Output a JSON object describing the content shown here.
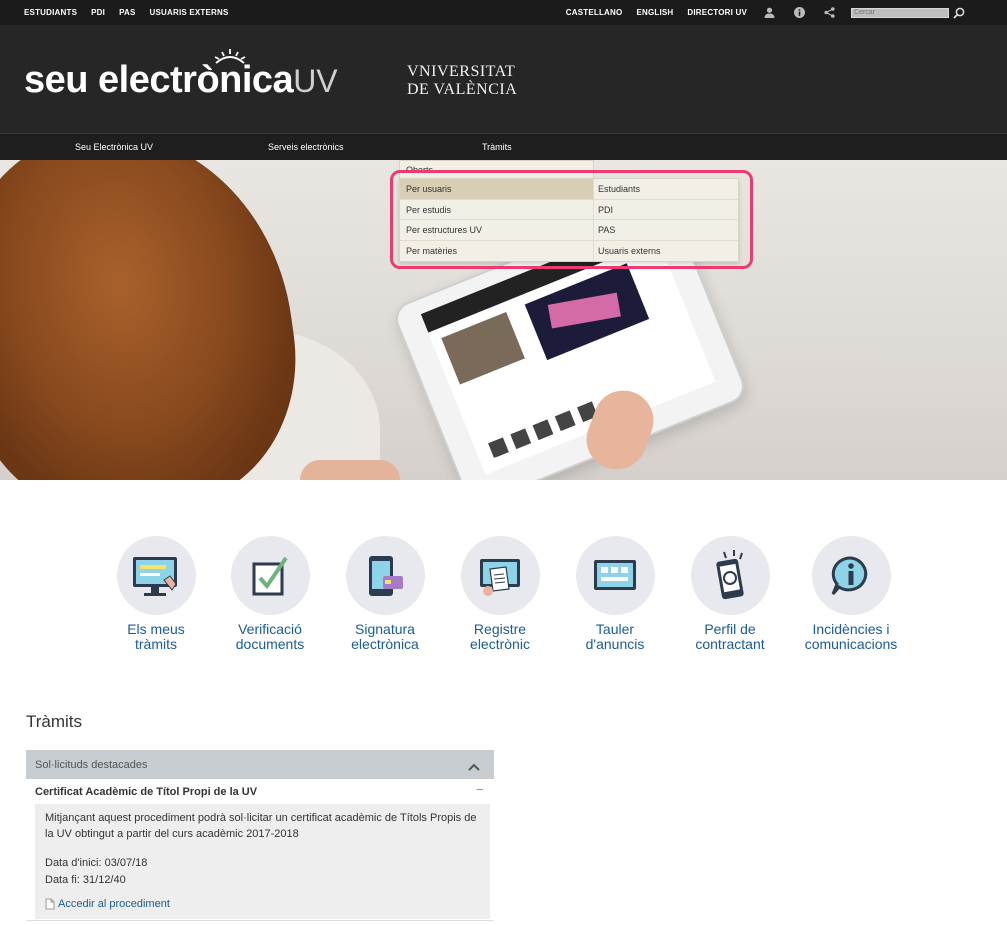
{
  "topbar": {
    "left_links": [
      "ESTUDIANTS",
      "PDI",
      "PAS",
      "USUARIS EXTERNS"
    ],
    "right_links": [
      "CASTELLANO",
      "ENGLISH",
      "DIRECTORI UV"
    ],
    "search_placeholder": "Cercar"
  },
  "header": {
    "brand_main": "seu electrònica",
    "brand_suffix": "UV",
    "uv_logo_line1": "VNIVERSITAT",
    "uv_logo_line2": "DE VALÈNCIA"
  },
  "nav": {
    "items": [
      "Seu Electrònica UV",
      "Serveis electrònics",
      "Tràmits"
    ]
  },
  "dropdown": {
    "first": "Oberts",
    "rows": [
      {
        "label": "Per usuaris",
        "sub": "Estudiants"
      },
      {
        "label": "Per estudis",
        "sub": "PDI"
      },
      {
        "label": "Per estructures UV",
        "sub": "PAS"
      },
      {
        "label": "Per matèries",
        "sub": "Usuaris externs"
      }
    ]
  },
  "services": [
    {
      "line1": "Els meus",
      "line2": "tràmits"
    },
    {
      "line1": "Verificació",
      "line2": "documents"
    },
    {
      "line1": "Signatura",
      "line2": "electrònica"
    },
    {
      "line1": "Registre",
      "line2": "electrònic"
    },
    {
      "line1": "Tauler",
      "line2": "d'anuncis"
    },
    {
      "line1": "Perfil de",
      "line2": "contractant"
    },
    {
      "line1": "Incidències i",
      "line2": "comunicacions"
    }
  ],
  "tramits": {
    "title": "Tràmits",
    "section": "Sol·licituds destacades",
    "item_title": "Certificat Acadèmic de Títol Propi de la UV",
    "description": "Mitjançant aquest procediment podrà sol·licitar un certificat acadèmic de Títols Propis de la UV obtingut a partir del curs acadèmic 2017-2018",
    "date_start": "Data d'inici: 03/07/18",
    "date_end": "Data fi: 31/12/40",
    "link": "Accedir al procediment"
  },
  "colors": {
    "topbar_bg": "#1b1b1b",
    "header_bg": "#262626",
    "link_blue": "#1b5b94",
    "highlight": "#ec3c6f",
    "dropdown_bg": "#f2efe6"
  }
}
